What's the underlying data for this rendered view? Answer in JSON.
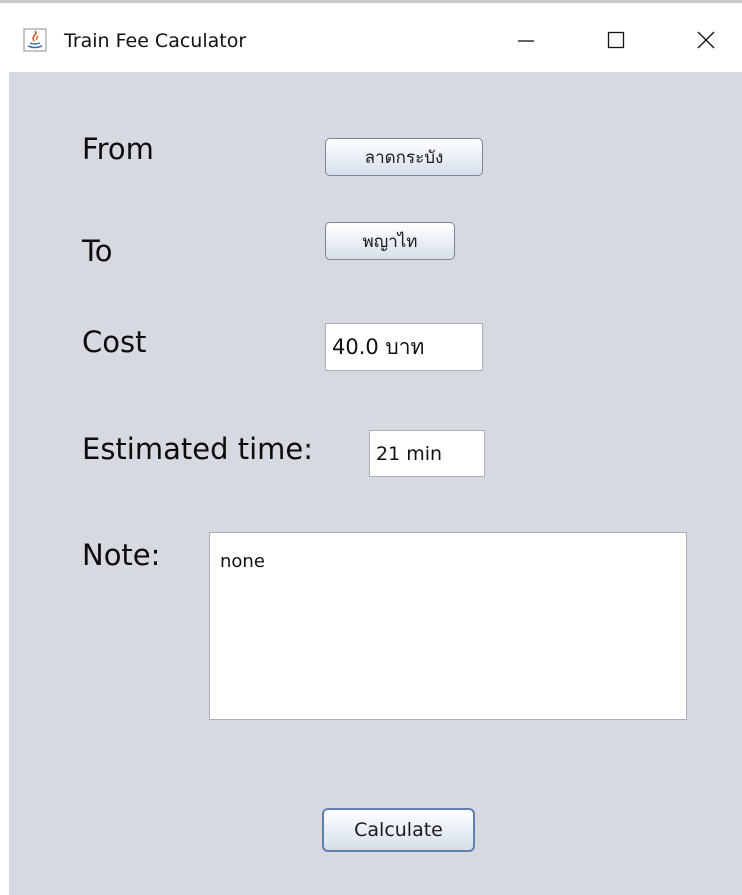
{
  "window": {
    "title": "Train Fee Caculator"
  },
  "form": {
    "from_label": "From",
    "from_value": "ลาดกระบัง",
    "to_label": "To",
    "to_value": "พญาไท",
    "cost_label": "Cost",
    "cost_value": "40.0 บาท",
    "time_label": "Estimated time:",
    "time_value": "21 min",
    "note_label": "Note:",
    "note_value": "none",
    "calculate_label": "Calculate"
  },
  "icons": {
    "app": "java-app-icon",
    "minimize": "minimize-icon",
    "maximize": "maximize-icon",
    "close": "close-icon"
  },
  "colors": {
    "content_background": "#d6d9e0",
    "button_border": "#7a8595"
  }
}
